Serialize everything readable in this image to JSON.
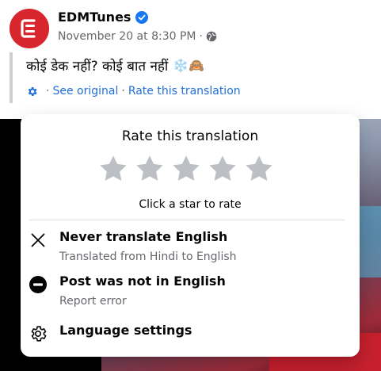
{
  "post": {
    "author": "EDMTunes",
    "timestamp": "November 20 at 8:30 PM",
    "audience_icon": "globe-icon",
    "text": "कोई डेक नहीं? कोई बात नहीं",
    "emojis": "❄️🙈",
    "translation_links": {
      "see_original": "See original",
      "rate_translation": "Rate this translation"
    }
  },
  "popup": {
    "title": "Rate this translation",
    "star_count": 5,
    "hint": "Click a star to rate",
    "items": [
      {
        "label": "Never translate English",
        "sublabel": "Translated from Hindi to English",
        "icon": "close-icon"
      },
      {
        "label": "Post was not in English",
        "sublabel": "Report error",
        "icon": "minus-circle-icon"
      },
      {
        "label": "Language settings",
        "sublabel": "",
        "icon": "gear-icon"
      }
    ]
  },
  "colors": {
    "brand_red": "#d8262e",
    "link_blue": "#216fdb",
    "verified_blue": "#1877f2",
    "star_gray": "#bcc0c4",
    "secondary_text": "#65676b"
  }
}
